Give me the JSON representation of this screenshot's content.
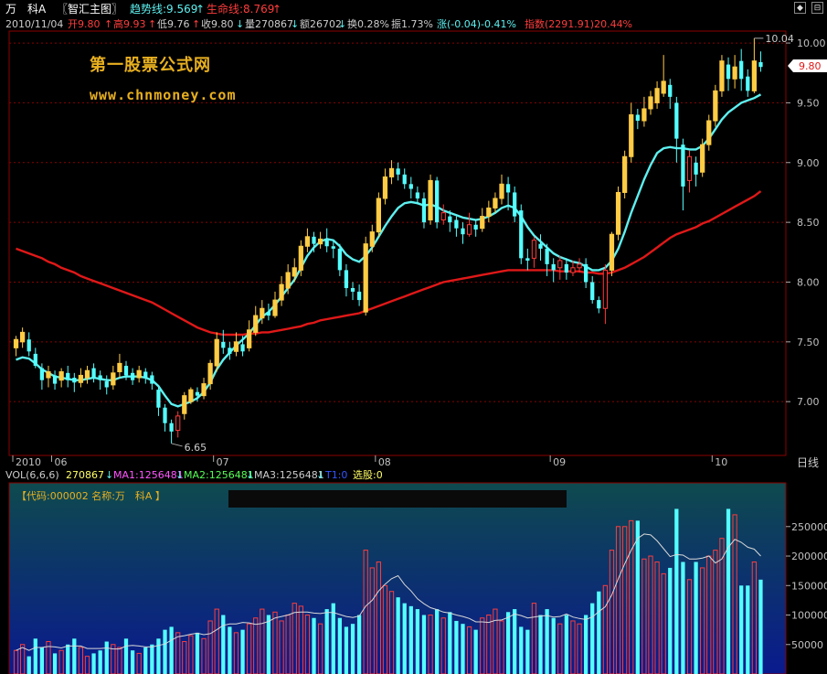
{
  "header": {
    "stock_short": "万　科A",
    "indicator_name": "〖智汇主图〗",
    "trend_label": "趋势线:9.569",
    "trend_arrow": "↑",
    "life_label": "生命线:8.769",
    "life_arrow": "↑",
    "date": "2010/11/04",
    "open": "开9.80",
    "open_arrow": "↑",
    "high": "高9.93",
    "high_arrow": "↑",
    "low": "低9.76",
    "low_arrow": "↑",
    "close": "收9.80",
    "close_arrow": "↓",
    "volume": "量270867",
    "volume_arrow": "↓",
    "amount": "额26702",
    "amount_arrow": "↓",
    "turnover": "换0.28%",
    "amplitude": "振1.73%",
    "change": "涨(-0.04)-0.41%",
    "index": "指数(2291.91)20.44%"
  },
  "watermark": {
    "line1": "第一股票公式网",
    "line2": "www.chnmoney.com"
  },
  "price_axis": {
    "ticks": [
      "10.00",
      "9.50",
      "9.00",
      "8.50",
      "8.00",
      "7.50",
      "7.00"
    ],
    "current": "9.80"
  },
  "annotations": {
    "high": "10.04",
    "low": "6.65"
  },
  "time_axis": {
    "labels": [
      "2010",
      "06",
      "07",
      "08",
      "09",
      "10",
      "11"
    ],
    "period": "日线"
  },
  "vol_header": {
    "name": "VOL(6,6,6)",
    "vol": "270867",
    "vol_arrow": "↓",
    "ma1": "MA1:1256481",
    "ma1_arrow": "↓",
    "ma2": "MA2:1256481",
    "ma2_arrow": "↓",
    "ma3": "MA3:1256481",
    "ma3_arrow": "↓",
    "t1": "T1:0",
    "pick": "选股:0"
  },
  "vol_panel": {
    "info": "【代码:000002 名称:万　科A 】",
    "ticks": [
      "250000",
      "200000",
      "150000",
      "100000",
      "50000"
    ]
  },
  "corner_buttons": [
    "◆",
    "⊟"
  ],
  "colors": {
    "up": "#ff3c3c",
    "down": "#54ffff",
    "yellow_candle": "#ffcc44",
    "trend": "#5ef0f0",
    "life": "#e01818",
    "grid": "#8b0000",
    "text": "#c0c0c0"
  },
  "chart_data": {
    "type": "candlestick",
    "title": "万　科A",
    "ylim": [
      6.55,
      10.1
    ],
    "candles": [
      [
        7.45,
        7.52,
        7.55,
        7.38
      ],
      [
        7.5,
        7.58,
        7.62,
        7.45
      ],
      [
        7.52,
        7.42,
        7.58,
        7.38
      ],
      [
        7.4,
        7.3,
        7.45,
        7.28
      ],
      [
        7.28,
        7.18,
        7.32,
        7.1
      ],
      [
        7.2,
        7.25,
        7.3,
        7.12
      ],
      [
        7.22,
        7.15,
        7.26,
        7.1
      ],
      [
        7.18,
        7.25,
        7.28,
        7.12
      ],
      [
        7.24,
        7.18,
        7.3,
        7.12
      ],
      [
        7.2,
        7.16,
        7.24,
        7.08
      ],
      [
        7.16,
        7.22,
        7.28,
        7.12
      ],
      [
        7.2,
        7.26,
        7.3,
        7.15
      ],
      [
        7.28,
        7.2,
        7.32,
        7.16
      ],
      [
        7.22,
        7.18,
        7.26,
        7.1
      ],
      [
        7.17,
        7.12,
        7.22,
        7.06
      ],
      [
        7.14,
        7.24,
        7.3,
        7.1
      ],
      [
        7.25,
        7.32,
        7.4,
        7.2
      ],
      [
        7.3,
        7.22,
        7.34,
        7.18
      ],
      [
        7.24,
        7.18,
        7.28,
        7.14
      ],
      [
        7.2,
        7.26,
        7.3,
        7.16
      ],
      [
        7.25,
        7.2,
        7.28,
        7.15
      ],
      [
        7.22,
        7.15,
        7.25,
        7.1
      ],
      [
        7.1,
        6.95,
        7.12,
        6.88
      ],
      [
        6.95,
        6.82,
        6.98,
        6.75
      ],
      [
        6.82,
        6.75,
        6.85,
        6.65
      ],
      [
        6.76,
        6.88,
        6.92,
        6.7
      ],
      [
        6.9,
        7.05,
        7.08,
        6.85
      ],
      [
        7.0,
        7.1,
        7.12,
        6.98
      ],
      [
        7.08,
        7.05,
        7.12,
        7.0
      ],
      [
        7.05,
        7.15,
        7.2,
        7.02
      ],
      [
        7.15,
        7.32,
        7.35,
        7.1
      ],
      [
        7.3,
        7.52,
        7.58,
        7.25
      ],
      [
        7.5,
        7.45,
        7.6,
        7.4
      ],
      [
        7.45,
        7.4,
        7.5,
        7.35
      ],
      [
        7.42,
        7.5,
        7.58,
        7.38
      ],
      [
        7.48,
        7.42,
        7.55,
        7.38
      ],
      [
        7.45,
        7.6,
        7.68,
        7.42
      ],
      [
        7.58,
        7.72,
        7.8,
        7.55
      ],
      [
        7.7,
        7.78,
        7.85,
        7.65
      ],
      [
        7.75,
        7.72,
        7.82,
        7.68
      ],
      [
        7.72,
        7.85,
        7.92,
        7.7
      ],
      [
        7.85,
        7.98,
        8.05,
        7.8
      ],
      [
        7.95,
        8.08,
        8.15,
        7.9
      ],
      [
        8.05,
        8.12,
        8.2,
        8.0
      ],
      [
        8.1,
        8.3,
        8.35,
        8.05
      ],
      [
        8.3,
        8.38,
        8.45,
        8.25
      ],
      [
        8.38,
        8.32,
        8.42,
        8.25
      ],
      [
        8.32,
        8.36,
        8.42,
        8.28
      ],
      [
        8.35,
        8.3,
        8.45,
        8.25
      ],
      [
        8.3,
        8.28,
        8.35,
        8.2
      ],
      [
        8.28,
        8.1,
        8.32,
        8.05
      ],
      [
        8.1,
        7.95,
        8.15,
        7.88
      ],
      [
        7.95,
        7.92,
        8.0,
        7.85
      ],
      [
        7.92,
        7.85,
        7.98,
        7.8
      ],
      [
        7.75,
        8.32,
        8.38,
        7.72
      ],
      [
        8.3,
        8.42,
        8.48,
        8.25
      ],
      [
        8.42,
        8.7,
        8.75,
        8.38
      ],
      [
        8.7,
        8.88,
        8.95,
        8.65
      ],
      [
        8.88,
        8.95,
        9.02,
        8.82
      ],
      [
        8.95,
        8.9,
        9.0,
        8.85
      ],
      [
        8.9,
        8.82,
        8.95,
        8.78
      ],
      [
        8.82,
        8.78,
        8.88,
        8.7
      ],
      [
        8.75,
        8.7,
        8.8,
        8.65
      ],
      [
        8.7,
        8.5,
        8.75,
        8.45
      ],
      [
        8.52,
        8.85,
        8.9,
        8.48
      ],
      [
        8.85,
        8.5,
        8.88,
        8.45
      ],
      [
        8.52,
        8.58,
        8.65,
        8.48
      ],
      [
        8.55,
        8.5,
        8.6,
        8.42
      ],
      [
        8.52,
        8.45,
        8.55,
        8.38
      ],
      [
        8.45,
        8.4,
        8.5,
        8.32
      ],
      [
        8.4,
        8.48,
        8.58,
        8.38
      ],
      [
        8.48,
        8.44,
        8.52,
        8.38
      ],
      [
        8.45,
        8.55,
        8.62,
        8.42
      ],
      [
        8.55,
        8.62,
        8.68,
        8.5
      ],
      [
        8.62,
        8.7,
        8.75,
        8.58
      ],
      [
        8.7,
        8.82,
        8.9,
        8.65
      ],
      [
        8.82,
        8.75,
        8.88,
        8.6
      ],
      [
        8.75,
        8.55,
        8.8,
        8.5
      ],
      [
        8.6,
        8.2,
        8.65,
        8.15
      ],
      [
        8.2,
        8.18,
        8.28,
        8.1
      ],
      [
        8.2,
        8.35,
        8.38,
        8.12
      ],
      [
        8.32,
        8.28,
        8.4,
        8.18
      ],
      [
        8.28,
        8.15,
        8.32,
        8.05
      ],
      [
        8.15,
        8.1,
        8.2,
        8.0
      ],
      [
        8.12,
        8.18,
        8.22,
        8.02
      ],
      [
        8.15,
        8.08,
        8.2,
        8.02
      ],
      [
        8.08,
        8.12,
        8.18,
        8.05
      ],
      [
        8.12,
        8.15,
        8.2,
        8.08
      ],
      [
        8.15,
        8.0,
        8.2,
        7.95
      ],
      [
        8.0,
        7.85,
        8.05,
        7.82
      ],
      [
        7.85,
        7.78,
        7.88,
        7.74
      ],
      [
        7.78,
        8.1,
        8.15,
        7.65
      ],
      [
        8.1,
        8.4,
        8.42,
        8.05
      ],
      [
        8.4,
        8.75,
        8.8,
        8.35
      ],
      [
        8.75,
        9.05,
        9.1,
        8.7
      ],
      [
        9.05,
        9.4,
        9.5,
        9.0
      ],
      [
        9.4,
        9.35,
        9.45,
        9.28
      ],
      [
        9.35,
        9.45,
        9.55,
        9.3
      ],
      [
        9.45,
        9.55,
        9.6,
        9.4
      ],
      [
        9.5,
        9.62,
        9.68,
        9.45
      ],
      [
        9.58,
        9.68,
        9.9,
        9.55
      ],
      [
        9.65,
        9.55,
        9.7,
        9.45
      ],
      [
        9.5,
        9.2,
        9.55,
        9.0
      ],
      [
        9.15,
        8.8,
        9.2,
        8.6
      ],
      [
        8.85,
        9.05,
        9.1,
        8.75
      ],
      [
        9.0,
        8.9,
        9.05,
        8.8
      ],
      [
        8.92,
        9.15,
        9.2,
        8.88
      ],
      [
        9.15,
        9.35,
        9.4,
        9.1
      ],
      [
        9.35,
        9.6,
        9.65,
        9.3
      ],
      [
        9.6,
        9.85,
        9.9,
        9.55
      ],
      [
        9.82,
        9.7,
        9.88,
        9.6
      ],
      [
        9.7,
        9.8,
        9.9,
        9.62
      ],
      [
        9.85,
        9.7,
        9.95,
        9.6
      ],
      [
        9.72,
        9.6,
        9.78,
        9.55
      ],
      [
        9.6,
        9.85,
        10.04,
        9.58
      ],
      [
        9.84,
        9.8,
        9.93,
        9.76
      ]
    ],
    "trend_line": [
      7.35,
      7.37,
      7.36,
      7.32,
      7.27,
      7.24,
      7.21,
      7.2,
      7.19,
      7.18,
      7.18,
      7.19,
      7.2,
      7.19,
      7.18,
      7.18,
      7.2,
      7.21,
      7.21,
      7.21,
      7.2,
      7.18,
      7.13,
      7.05,
      6.98,
      6.96,
      6.98,
      7.0,
      7.03,
      7.08,
      7.16,
      7.27,
      7.35,
      7.41,
      7.47,
      7.52,
      7.57,
      7.64,
      7.71,
      7.75,
      7.81,
      7.88,
      7.95,
      8.02,
      8.12,
      8.22,
      8.29,
      8.34,
      8.36,
      8.35,
      8.3,
      8.23,
      8.19,
      8.17,
      8.22,
      8.29,
      8.38,
      8.47,
      8.55,
      8.62,
      8.66,
      8.67,
      8.66,
      8.64,
      8.65,
      8.63,
      8.6,
      8.58,
      8.56,
      8.54,
      8.53,
      8.52,
      8.53,
      8.55,
      8.58,
      8.62,
      8.64,
      8.62,
      8.55,
      8.46,
      8.39,
      8.34,
      8.29,
      8.24,
      8.21,
      8.19,
      8.17,
      8.16,
      8.13,
      8.1,
      8.1,
      8.12,
      8.18,
      8.28,
      8.42,
      8.58,
      8.72,
      8.86,
      8.98,
      9.08,
      9.12,
      9.13,
      9.12,
      9.12,
      9.11,
      9.11,
      9.14,
      9.2,
      9.28,
      9.36,
      9.42,
      9.46,
      9.5,
      9.52,
      9.54,
      9.57
    ],
    "life_line": [
      8.28,
      8.26,
      8.24,
      8.22,
      8.2,
      8.17,
      8.15,
      8.12,
      8.1,
      8.08,
      8.05,
      8.03,
      8.01,
      7.99,
      7.97,
      7.95,
      7.93,
      7.91,
      7.89,
      7.87,
      7.85,
      7.83,
      7.8,
      7.77,
      7.74,
      7.71,
      7.68,
      7.65,
      7.62,
      7.6,
      7.58,
      7.57,
      7.56,
      7.56,
      7.56,
      7.56,
      7.57,
      7.57,
      7.58,
      7.58,
      7.59,
      7.6,
      7.61,
      7.62,
      7.63,
      7.65,
      7.66,
      7.68,
      7.69,
      7.7,
      7.71,
      7.72,
      7.73,
      7.74,
      7.76,
      7.78,
      7.8,
      7.82,
      7.84,
      7.86,
      7.88,
      7.9,
      7.92,
      7.94,
      7.96,
      7.98,
      8.0,
      8.01,
      8.02,
      8.03,
      8.04,
      8.05,
      8.06,
      8.07,
      8.08,
      8.09,
      8.1,
      8.1,
      8.1,
      8.1,
      8.1,
      8.1,
      8.1,
      8.1,
      8.09,
      8.09,
      8.09,
      8.09,
      8.08,
      8.08,
      8.07,
      8.07,
      8.08,
      8.1,
      8.12,
      8.15,
      8.18,
      8.21,
      8.25,
      8.29,
      8.33,
      8.37,
      8.4,
      8.42,
      8.44,
      8.46,
      8.49,
      8.51,
      8.54,
      8.57,
      8.6,
      8.63,
      8.66,
      8.69,
      8.72,
      8.76
    ],
    "volume": [
      40,
      50,
      30,
      60,
      45,
      55,
      35,
      40,
      50,
      60,
      45,
      30,
      35,
      40,
      55,
      50,
      45,
      60,
      40,
      35,
      45,
      50,
      60,
      75,
      80,
      70,
      55,
      65,
      70,
      60,
      90,
      110,
      100,
      80,
      70,
      75,
      85,
      95,
      110,
      100,
      105,
      90,
      100,
      120,
      115,
      100,
      95,
      85,
      110,
      120,
      95,
      80,
      85,
      100,
      210,
      180,
      190,
      150,
      140,
      130,
      120,
      115,
      110,
      100,
      100,
      110,
      95,
      105,
      90,
      85,
      80,
      75,
      95,
      100,
      110,
      90,
      105,
      110,
      80,
      75,
      120,
      100,
      110,
      95,
      85,
      100,
      90,
      85,
      100,
      120,
      140,
      150,
      210,
      250,
      250,
      260,
      260,
      195,
      200,
      190,
      170,
      180,
      280,
      190,
      160,
      190,
      180,
      200,
      210,
      230,
      280,
      270,
      150,
      150,
      190,
      160,
      110
    ]
  }
}
